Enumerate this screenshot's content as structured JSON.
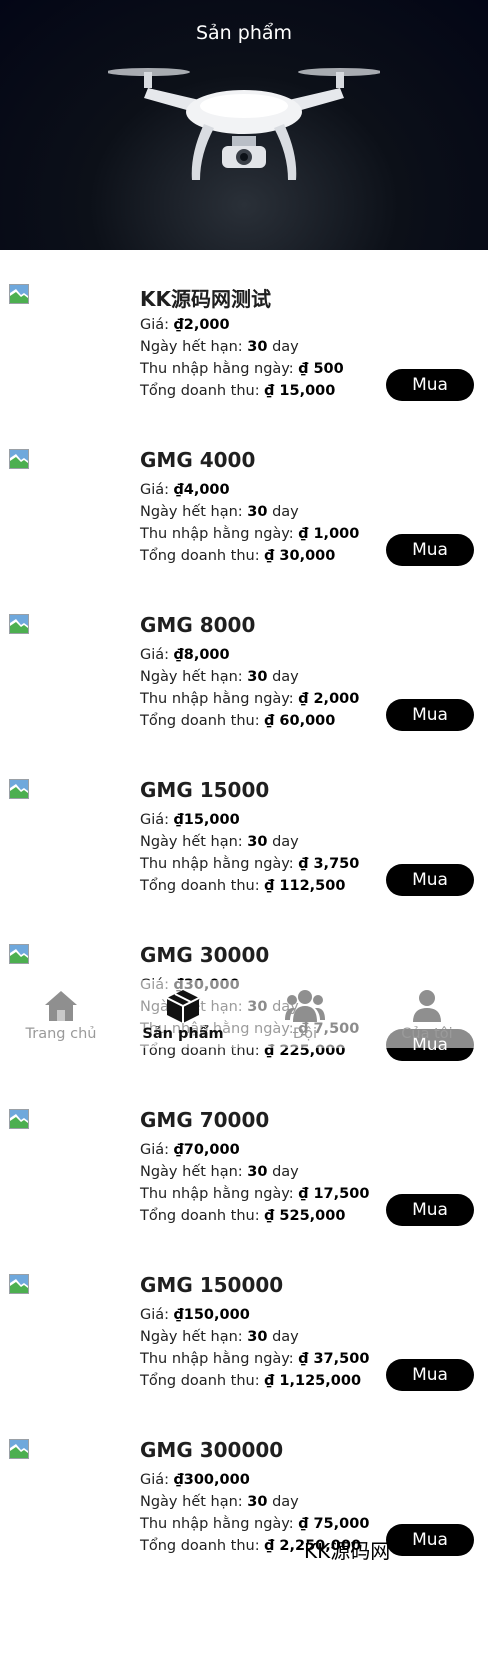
{
  "header": {
    "title": "Sản phẩm"
  },
  "labels": {
    "price": "Giá: ",
    "expiry": "Ngày hết hạn: ",
    "daily_income": "Thu nhập hằng ngày: ",
    "total_revenue": "Tổng doanh thu: ",
    "currency": "₫",
    "day_unit": " day",
    "buy_button": "Mua"
  },
  "products": [
    {
      "name": "KK源码网测试",
      "price": "2,000",
      "days": "30",
      "daily": "500",
      "total": "15,000"
    },
    {
      "name": "GMG 4000",
      "price": "4,000",
      "days": "30",
      "daily": "1,000",
      "total": "30,000"
    },
    {
      "name": "GMG 8000",
      "price": "8,000",
      "days": "30",
      "daily": "2,000",
      "total": "60,000"
    },
    {
      "name": "GMG 15000",
      "price": "15,000",
      "days": "30",
      "daily": "3,750",
      "total": "112,500"
    },
    {
      "name": "GMG 30000",
      "price": "30,000",
      "days": "30",
      "daily": "7,500",
      "total": "225,000"
    },
    {
      "name": "GMG 70000",
      "price": "70,000",
      "days": "30",
      "daily": "17,500",
      "total": "525,000"
    },
    {
      "name": "GMG 150000",
      "price": "150,000",
      "days": "30",
      "daily": "37,500",
      "total": "1,125,000"
    },
    {
      "name": "GMG 300000",
      "price": "300,000",
      "days": "30",
      "daily": "75,000",
      "total": "2,250,000"
    }
  ],
  "tabbar": {
    "items": [
      {
        "label": "Trang chủ",
        "icon": "home-icon",
        "active": false
      },
      {
        "label": "Sản phẩm",
        "icon": "box-icon",
        "active": true
      },
      {
        "label": "Đội",
        "icon": "team-icon",
        "active": false
      },
      {
        "label": "Của tôi",
        "icon": "user-icon",
        "active": false
      }
    ]
  },
  "watermark": "KK源码网",
  "colors": {
    "hero_bg": "#030616",
    "button_bg": "#000000",
    "tab_inactive": "#9a9a9a"
  }
}
